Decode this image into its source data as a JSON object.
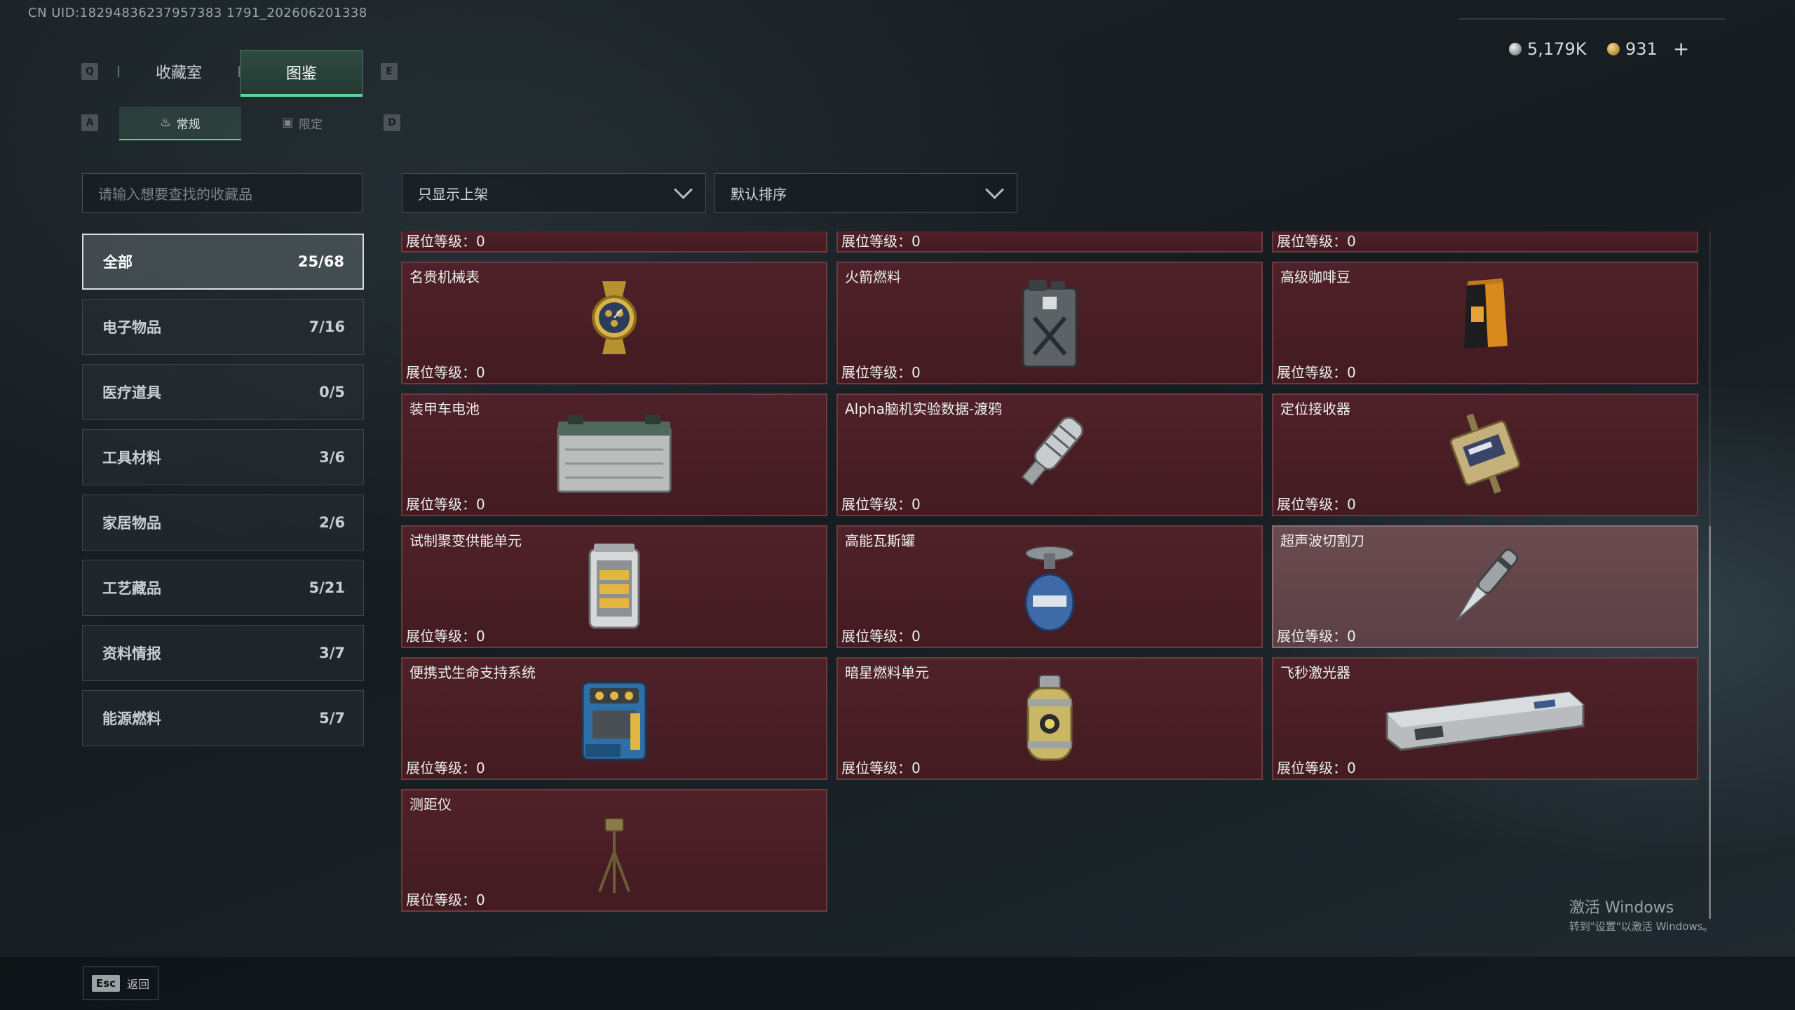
{
  "uid_text": "CN UID:18294836237957383 1791_202606201338",
  "currency": {
    "silver": "5,179K",
    "gold": "931",
    "plus": "+"
  },
  "keys": {
    "prev_tab": "Q",
    "next_tab": "E",
    "prev_sub": "A",
    "next_sub": "D"
  },
  "tabs": [
    {
      "label": "收藏室"
    },
    {
      "label": "图鉴"
    }
  ],
  "subtabs": [
    {
      "label": "常规"
    },
    {
      "label": "限定"
    }
  ],
  "search": {
    "placeholder": "请输入想要查找的收藏品"
  },
  "filters": {
    "shelf": "只显示上架",
    "sort": "默认排序"
  },
  "categories": [
    {
      "label": "全部",
      "count": "25/68"
    },
    {
      "label": "电子物品",
      "count": "7/16"
    },
    {
      "label": "医疗道具",
      "count": "0/5"
    },
    {
      "label": "工具材料",
      "count": "3/6"
    },
    {
      "label": "家居物品",
      "count": "2/6"
    },
    {
      "label": "工艺藏品",
      "count": "5/21"
    },
    {
      "label": "资料情报",
      "count": "3/7"
    },
    {
      "label": "能源燃料",
      "count": "5/7"
    }
  ],
  "partial_row": [
    {
      "level": "展位等级：0"
    },
    {
      "level": "展位等级：0"
    },
    {
      "level": "展位等级：0"
    }
  ],
  "items": [
    {
      "name": "名贵机械表",
      "level": "展位等级：0",
      "icon": "watch-icon"
    },
    {
      "name": "火箭燃料",
      "level": "展位等级：0",
      "icon": "fuel-can-icon"
    },
    {
      "name": "高级咖啡豆",
      "level": "展位等级：0",
      "icon": "coffee-bag-icon"
    },
    {
      "name": "装甲车电池",
      "level": "展位等级：0",
      "icon": "battery-icon"
    },
    {
      "name": "Alpha脑机实验数据-渡鸦",
      "level": "展位等级：0",
      "icon": "data-drive-icon"
    },
    {
      "name": "定位接收器",
      "level": "展位等级：0",
      "icon": "receiver-icon"
    },
    {
      "name": "试制聚变供能单元",
      "level": "展位等级：0",
      "icon": "fusion-cell-icon"
    },
    {
      "name": "高能瓦斯罐",
      "level": "展位等级：0",
      "icon": "gas-tank-icon"
    },
    {
      "name": "超声波切割刀",
      "level": "展位等级：0",
      "icon": "ultrasonic-knife-icon"
    },
    {
      "name": "便携式生命支持系统",
      "level": "展位等级：0",
      "icon": "life-support-icon"
    },
    {
      "name": "暗星燃料单元",
      "level": "展位等级：0",
      "icon": "fuel-cell-icon"
    },
    {
      "name": "飞秒激光器",
      "level": "展位等级：0",
      "icon": "laser-case-icon"
    },
    {
      "name": "测距仪",
      "level": "展位等级：0",
      "icon": "rangefinder-icon"
    }
  ],
  "footer": {
    "esc_key": "Esc",
    "esc_label": "返回"
  },
  "watermark": {
    "line1": "激活 Windows",
    "line2": "转到\"设置\"以激活 Windows。"
  },
  "colors": {
    "accent": "#5fd49a",
    "card_bg": "#4a1e24",
    "card_highlight": "#634549"
  }
}
